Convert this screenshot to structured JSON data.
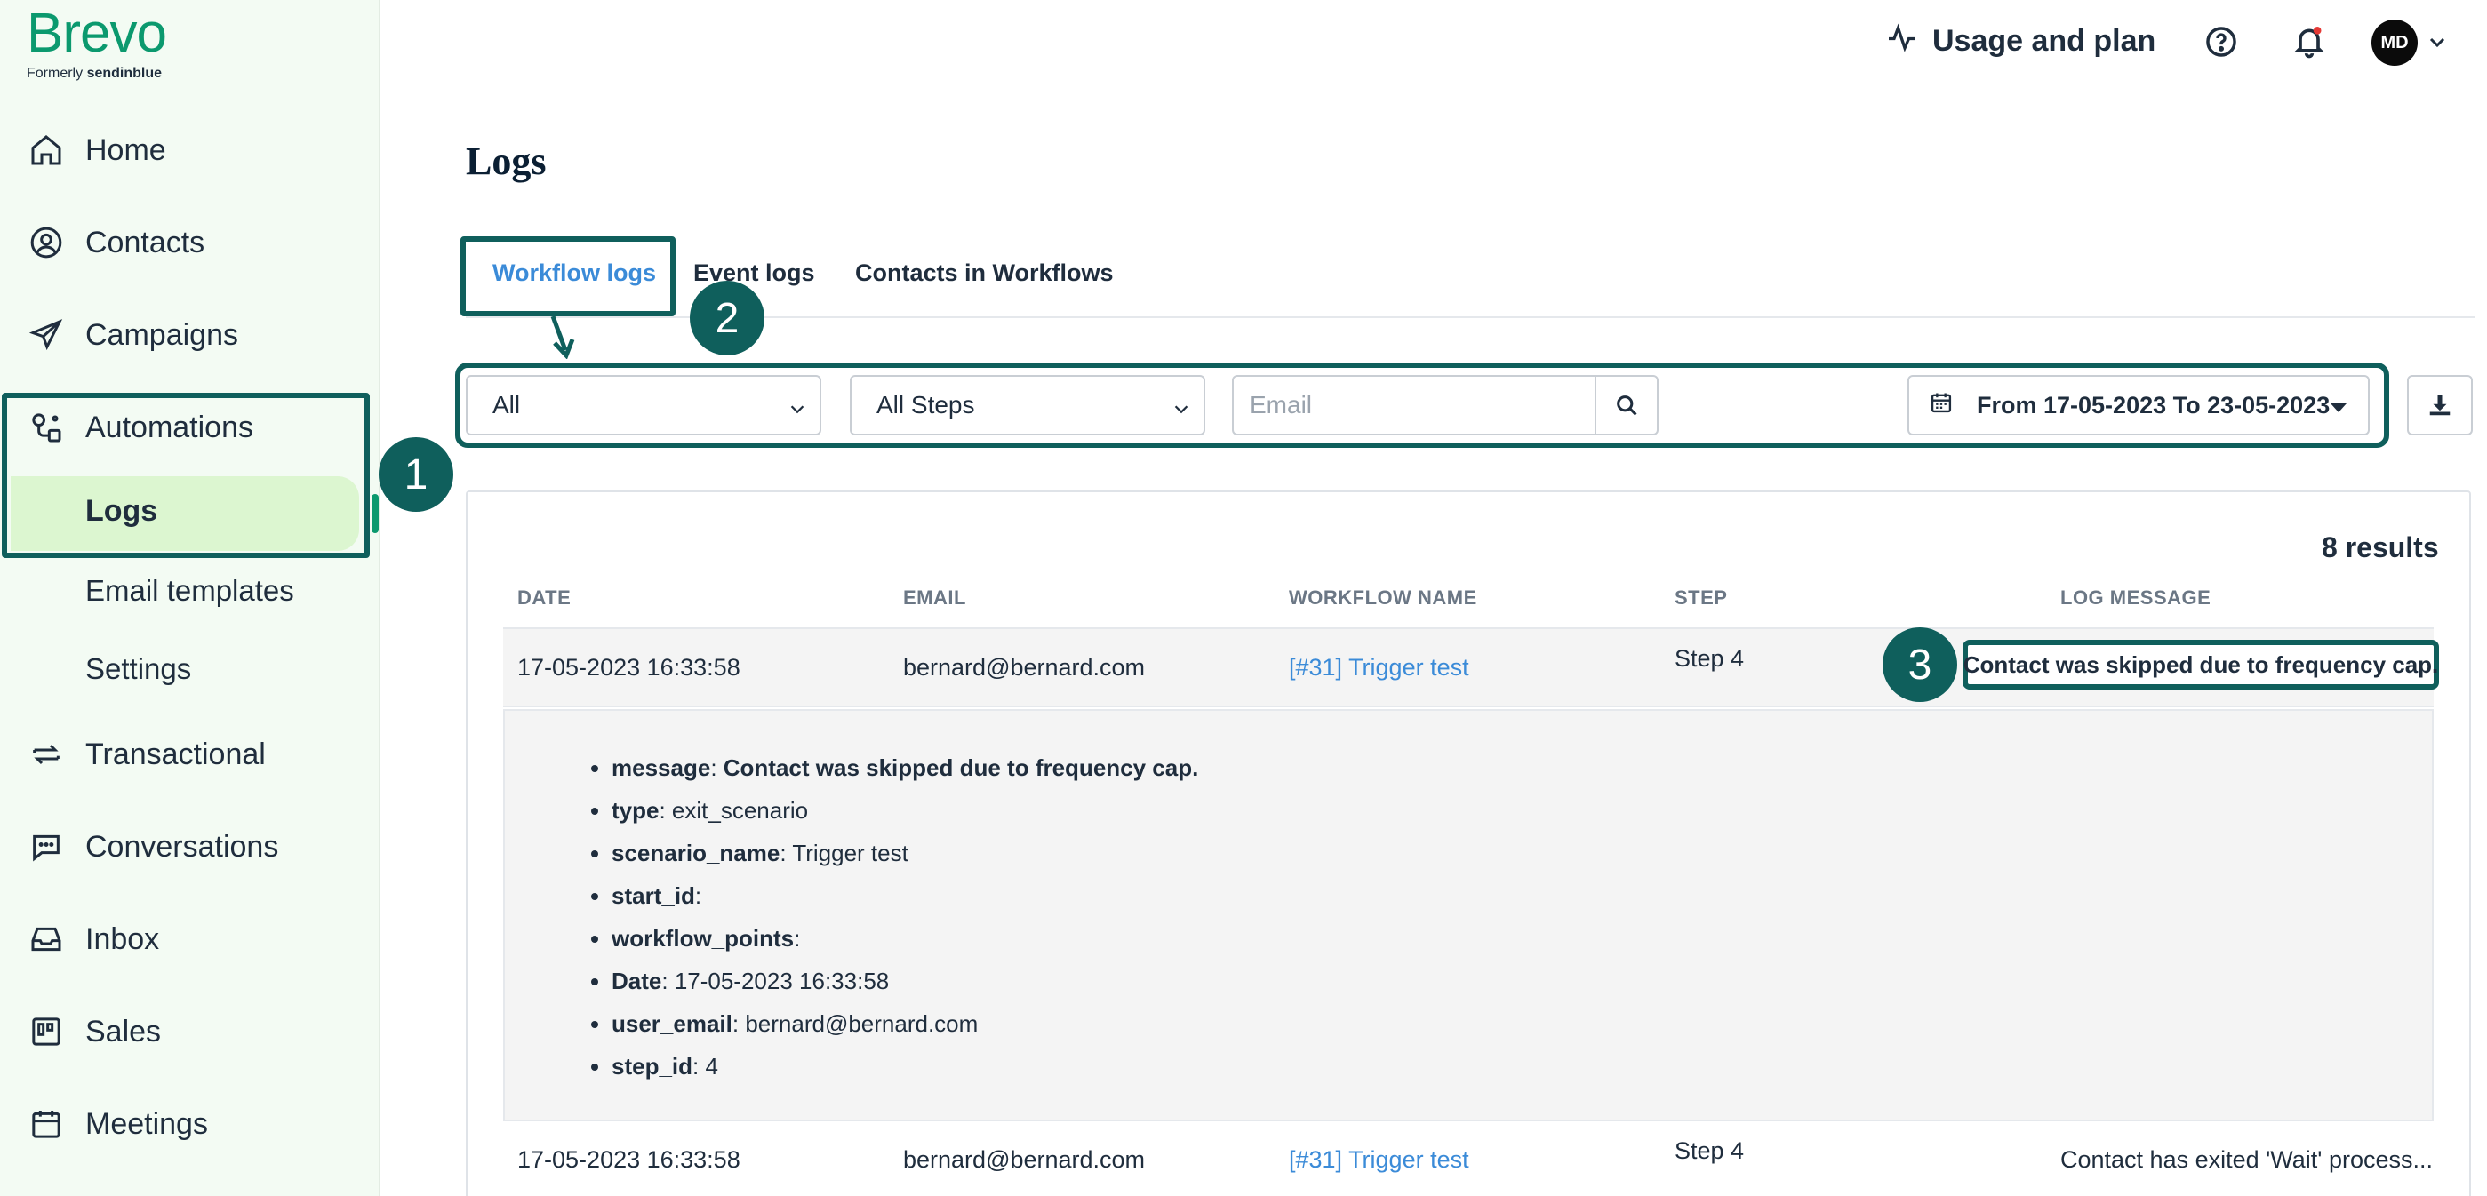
{
  "brand": {
    "name": "Brevo",
    "formerly_prefix": "Formerly ",
    "formerly_name": "sendinblue"
  },
  "sidebar": {
    "items": [
      {
        "label": "Home",
        "icon": "home-icon"
      },
      {
        "label": "Contacts",
        "icon": "contacts-icon"
      },
      {
        "label": "Campaigns",
        "icon": "paper-plane-icon"
      },
      {
        "label": "Automations",
        "icon": "automation-icon"
      },
      {
        "label": "Transactional",
        "icon": "transactional-icon"
      },
      {
        "label": "Conversations",
        "icon": "chat-icon"
      },
      {
        "label": "Inbox",
        "icon": "inbox-icon"
      },
      {
        "label": "Sales",
        "icon": "kanban-icon"
      },
      {
        "label": "Meetings",
        "icon": "calendar-icon"
      }
    ],
    "automation_sub": [
      "Logs",
      "Email templates",
      "Settings"
    ]
  },
  "topbar": {
    "usage_label": "Usage and plan",
    "avatar_initials": "MD"
  },
  "page": {
    "title": "Logs"
  },
  "tabs": [
    "Workflow logs",
    "Event logs",
    "Contacts in Workflows"
  ],
  "filters": {
    "status_value": "All",
    "steps_value": "All Steps",
    "email_placeholder": "Email",
    "date_range": "From 17-05-2023 To 23-05-2023"
  },
  "results": {
    "count_label": "8 results"
  },
  "table": {
    "headers": [
      "DATE",
      "EMAIL",
      "WORKFLOW NAME",
      "STEP",
      "LOG MESSAGE"
    ],
    "rows": [
      {
        "date": "17-05-2023 16:33:58",
        "email": "bernard@bernard.com",
        "workflow": "[#31] Trigger test",
        "step": "Step 4",
        "message": "Contact was skipped due to frequency cap."
      },
      {
        "date": "17-05-2023 16:33:58",
        "email": "bernard@bernard.com",
        "workflow": "[#31] Trigger test",
        "step": "Step 4",
        "message": "Contact has exited 'Wait' process..."
      }
    ],
    "detail": [
      {
        "key": "message",
        "value": "Contact was skipped due to frequency cap."
      },
      {
        "key": "type",
        "value": "exit_scenario"
      },
      {
        "key": "scenario_name",
        "value": "Trigger test"
      },
      {
        "key": "start_id",
        "value": ""
      },
      {
        "key": "workflow_points",
        "value": ""
      },
      {
        "key": "Date",
        "value": "17-05-2023 16:33:58"
      },
      {
        "key": "user_email",
        "value": "bernard@bernard.com"
      },
      {
        "key": "step_id",
        "value": "4"
      }
    ]
  },
  "annotations": [
    "1",
    "2",
    "3"
  ],
  "colors": {
    "brand_green": "#0b996e",
    "annotation": "#0f5f5c",
    "link_blue": "#3b8bd8",
    "active_bg": "#dcf6d0",
    "sidebar_bg": "#f3fbf3"
  }
}
